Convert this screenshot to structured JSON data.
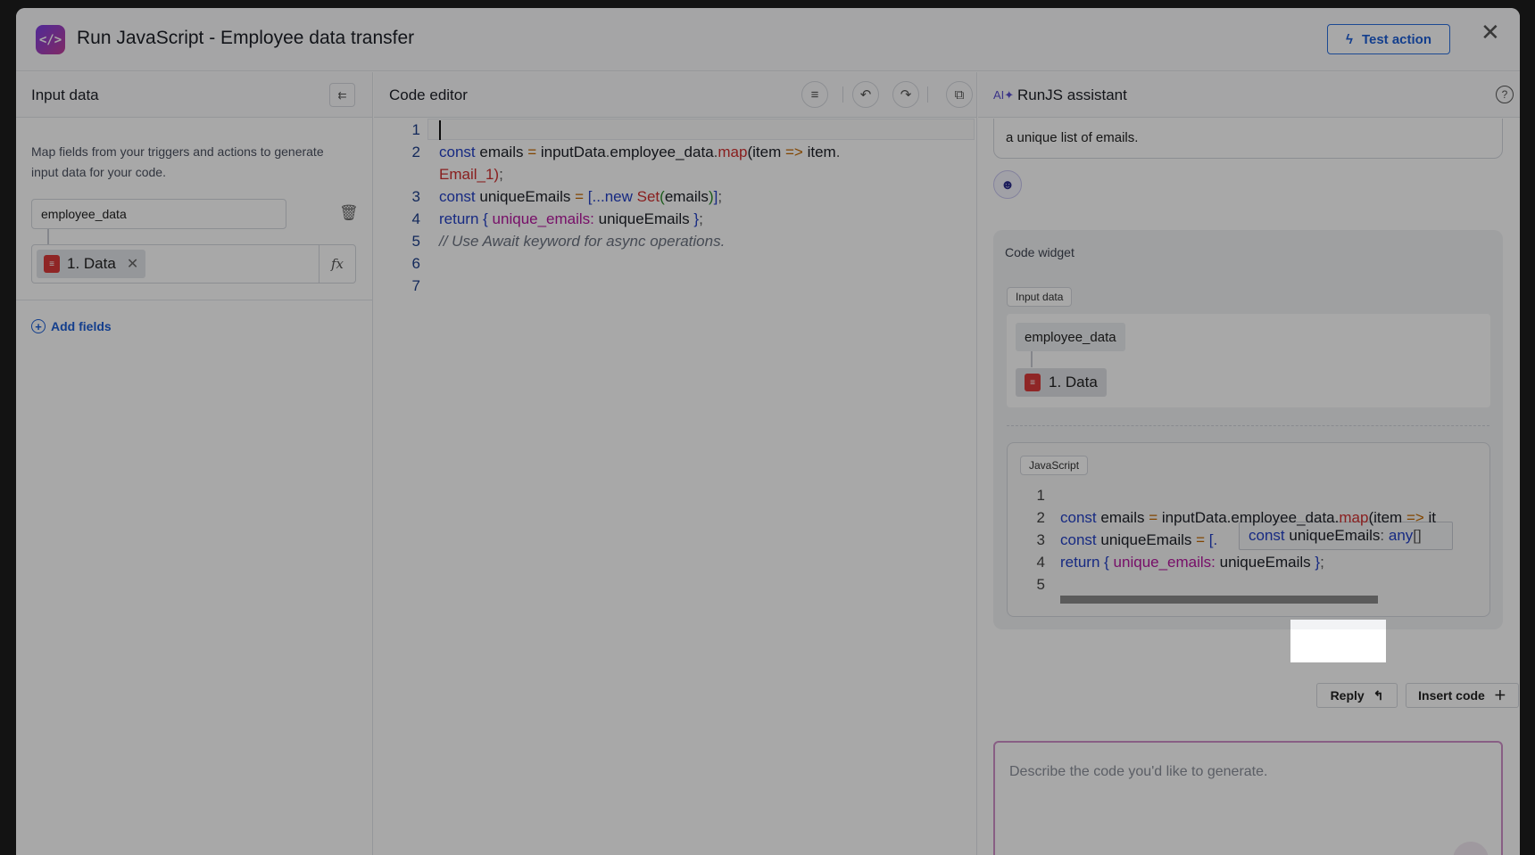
{
  "header": {
    "title": "Run JavaScript - Employee data transfer",
    "app_icon": "code-icon",
    "test_action_label": "Test action",
    "close_icon": "close-icon"
  },
  "input_panel": {
    "title": "Input data",
    "description": "Map fields from your triggers and actions to generate input data for your code.",
    "field_name": "employee_data",
    "mapped_value": "1. Data",
    "fx_label": "fx",
    "add_fields_label": "Add fields"
  },
  "editor": {
    "title": "Code editor",
    "toolbar": [
      "format-icon",
      "undo-icon",
      "redo-icon",
      "copy-icon"
    ],
    "lines": [
      [],
      [
        [
          "kw",
          "const "
        ],
        [
          "tx",
          "emails "
        ],
        [
          "op",
          "= "
        ],
        [
          "tx",
          "inputData"
        ],
        [
          "pn",
          "."
        ],
        [
          "tx",
          "employee_data"
        ],
        [
          "pn",
          "."
        ],
        [
          "fn",
          "map"
        ],
        [
          "tx",
          "(item "
        ],
        [
          "op",
          "=> "
        ],
        [
          "tx",
          "item"
        ],
        [
          "pn",
          "."
        ],
        [
          "wrap",
          ""
        ],
        [
          "fn",
          "Email_1)"
        ],
        [
          "pn",
          ";"
        ]
      ],
      [
        [
          "kw",
          "const "
        ],
        [
          "tx",
          "uniqueEmails "
        ],
        [
          "op",
          "= "
        ],
        [
          "kw",
          "[...new "
        ],
        [
          "fn",
          "Set"
        ],
        [
          "gr",
          "("
        ],
        [
          "tx",
          "emails"
        ],
        [
          "gr",
          ")"
        ],
        [
          "kw",
          "]"
        ],
        [
          "pn",
          ";"
        ]
      ],
      [
        [
          "kw",
          "return { "
        ],
        [
          "pr",
          "unique_emails: "
        ],
        [
          "tx",
          "uniqueEmails "
        ],
        [
          "kw",
          "}"
        ],
        [
          "pn",
          ";"
        ]
      ],
      [
        [
          "cm",
          "// Use Await keyword for async operations."
        ]
      ],
      [],
      []
    ]
  },
  "assistant": {
    "title": "RunJS assistant",
    "previous_message": "a unique list of emails.",
    "widget_title": "Code widget",
    "input_data_tag": "Input data",
    "field_name": "employee_data",
    "mapped_value": "1. Data",
    "language_tag": "JavaScript",
    "code_lines": [
      [],
      [
        [
          "kw",
          "const "
        ],
        [
          "tx",
          "emails "
        ],
        [
          "op",
          "= "
        ],
        [
          "tx",
          "inputData.employee_data."
        ],
        [
          "fn",
          "map"
        ],
        [
          "tx",
          "(item "
        ],
        [
          "op",
          "=> "
        ],
        [
          "tx",
          "it"
        ]
      ],
      [
        [
          "kw",
          "const "
        ],
        [
          "tx",
          "uniqueEmails "
        ],
        [
          "op",
          "= "
        ],
        [
          "kw",
          "[."
        ]
      ],
      [
        [
          "kw",
          "return { "
        ],
        [
          "pr",
          "unique_emails: "
        ],
        [
          "tx",
          "uniqueEmails "
        ],
        [
          "kw",
          "}"
        ],
        [
          "pn",
          ";"
        ]
      ],
      []
    ],
    "tooltip": {
      "kw": "const ",
      "name": "uniqueEmails",
      "sep": ": ",
      "type": "any",
      "brackets": "[]"
    },
    "reply_label": "Reply",
    "insert_code_label": "Insert code",
    "prompt_placeholder": "Describe the code you'd like to generate."
  }
}
